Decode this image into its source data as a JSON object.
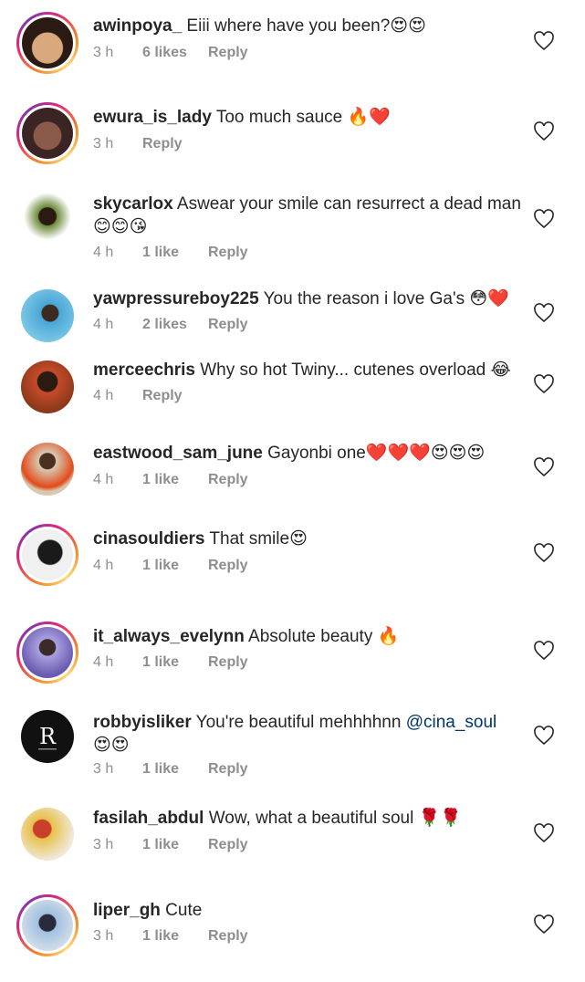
{
  "comments": [
    {
      "user": "awinpoya_",
      "text": " Eiii where have you been?😍😍",
      "time": "3 h",
      "likes": "6 likes",
      "reply": "Reply",
      "avatar_colors": [
        "#d9a87c",
        "#2b1a14"
      ]
    },
    {
      "user": "ewura_is_lady",
      "text": " Too much sauce 🔥❤️",
      "time": "3 h",
      "likes": "",
      "reply": "Reply",
      "avatar_colors": [
        "#3a2424",
        "#8a5a4a"
      ]
    },
    {
      "user": "skycarlox",
      "text": " Aswear your smile can resurrect a dead man😊😊😘",
      "time": "4 h",
      "likes": "1 like",
      "reply": "Reply",
      "avatar_colors": [
        "#6a8a3a",
        "#2a1a12"
      ]
    },
    {
      "user": "yawpressureboy225",
      "text": " You the reason i love Ga's 😳❤️",
      "time": "4 h",
      "likes": "2 likes",
      "reply": "Reply",
      "avatar_colors": [
        "#4aa6d6",
        "#3a2a20"
      ]
    },
    {
      "user": "merceechris",
      "text": " Why so hot Twiny... cutenes overload 😂",
      "time": "4 h",
      "likes": "",
      "reply": "Reply",
      "avatar_colors": [
        "#c84a2a",
        "#2a1a10"
      ]
    },
    {
      "user": "eastwood_sam_june",
      "text": " Gayonbi one❤️❤️❤️😍😍😍",
      "time": "4 h",
      "likes": "1 like",
      "reply": "Reply",
      "avatar_colors": [
        "#d8c8b0",
        "#e24a1a"
      ]
    },
    {
      "user": "cinasouldiers",
      "text": " That smile😍",
      "time": "4 h",
      "likes": "1 like",
      "reply": "Reply",
      "avatar_colors": [
        "#f0f0f0",
        "#1a1a1a"
      ]
    },
    {
      "user": "it_always_evelynn",
      "text": " Absolute beauty 🔥",
      "time": "4 h",
      "likes": "1 like",
      "reply": "Reply",
      "avatar_colors": [
        "#a9a0e0",
        "#3a2a28"
      ]
    },
    {
      "user": "robbyisliker",
      "text": " You're beautiful mehhhhnn ",
      "mention": "@cina_soul",
      "text2": "😍😍",
      "time": "3 h",
      "likes": "1 like",
      "reply": "Reply",
      "avatar_colors": [
        "#111111",
        "#ffffff"
      ],
      "avatar_letter": "R"
    },
    {
      "user": "fasilah_abdul",
      "text": " Wow, what a beautiful soul 🌹🌹",
      "time": "3 h",
      "likes": "1 like",
      "reply": "Reply",
      "avatar_colors": [
        "#e8c04a",
        "#c8402a"
      ]
    },
    {
      "user": "liper_gh",
      "text": " Cute",
      "time": "3 h",
      "likes": "1 like",
      "reply": "Reply",
      "avatar_colors": [
        "#a0c0e0",
        "#2a2a3a"
      ]
    }
  ]
}
